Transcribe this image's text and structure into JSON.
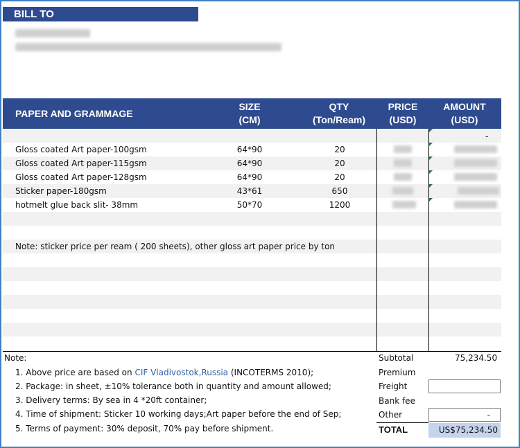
{
  "bill_to": {
    "label": "BILL TO"
  },
  "table": {
    "headers": {
      "paper": "PAPER AND GRAMMAGE",
      "size_1": "SIZE",
      "size_2": "(CM)",
      "qty_1": "QTY",
      "qty_2": "(Ton/Ream)",
      "price_1": "PRICE",
      "price_2": "(USD)",
      "amount_1": "AMOUNT",
      "amount_2": "(USD)"
    },
    "dash_amount": "-",
    "rows": [
      {
        "name": "Gloss coated Art paper-100gsm",
        "size": "64*90",
        "qty": "20"
      },
      {
        "name": "Gloss coated Art paper-115gsm",
        "size": "64*90",
        "qty": "20"
      },
      {
        "name": "Gloss coated Art paper-128gsm",
        "size": "64*90",
        "qty": "20"
      },
      {
        "name": "Sticker paper-180gsm",
        "size": "43*61",
        "qty": "650"
      },
      {
        "name": "hotmelt glue  back slit- 38mm",
        "size": "50*70",
        "qty": "1200"
      }
    ],
    "note": "Note: sticker price per ream ( 200 sheets), other gloss art paper price by ton"
  },
  "notes": {
    "title": "Note:",
    "item1_pre": "1. Above price are based on ",
    "item1_link": "CIF Vladivostok,Russia",
    "item1_post": " (INCOTERMS 2010);",
    "item2": "2. Package: in sheet, ±10% tolerance both in quantity and amount allowed;",
    "item3": "3. Delivery terms: By sea in 4 *20ft container;",
    "item4": "4. Time of shipment: Sticker 10 working days;Art paper before the end of Sep;",
    "item5": "5. Terms of payment: 30% deposit, 70% pay before shipment."
  },
  "summary": {
    "subtotal_label": "Subtotal",
    "subtotal_value": "75,234.50",
    "premium_label": "Premium",
    "freight_label": "Freight",
    "bank_fee_label": "Bank fee",
    "other_label": "Other",
    "other_value": "-",
    "total_label": "TOTAL",
    "total_value": "US$75,234.50"
  },
  "colors": {
    "header_bg": "#2f4b8f",
    "total_bg": "#c6d3ec",
    "border": "#3d7fc4"
  }
}
